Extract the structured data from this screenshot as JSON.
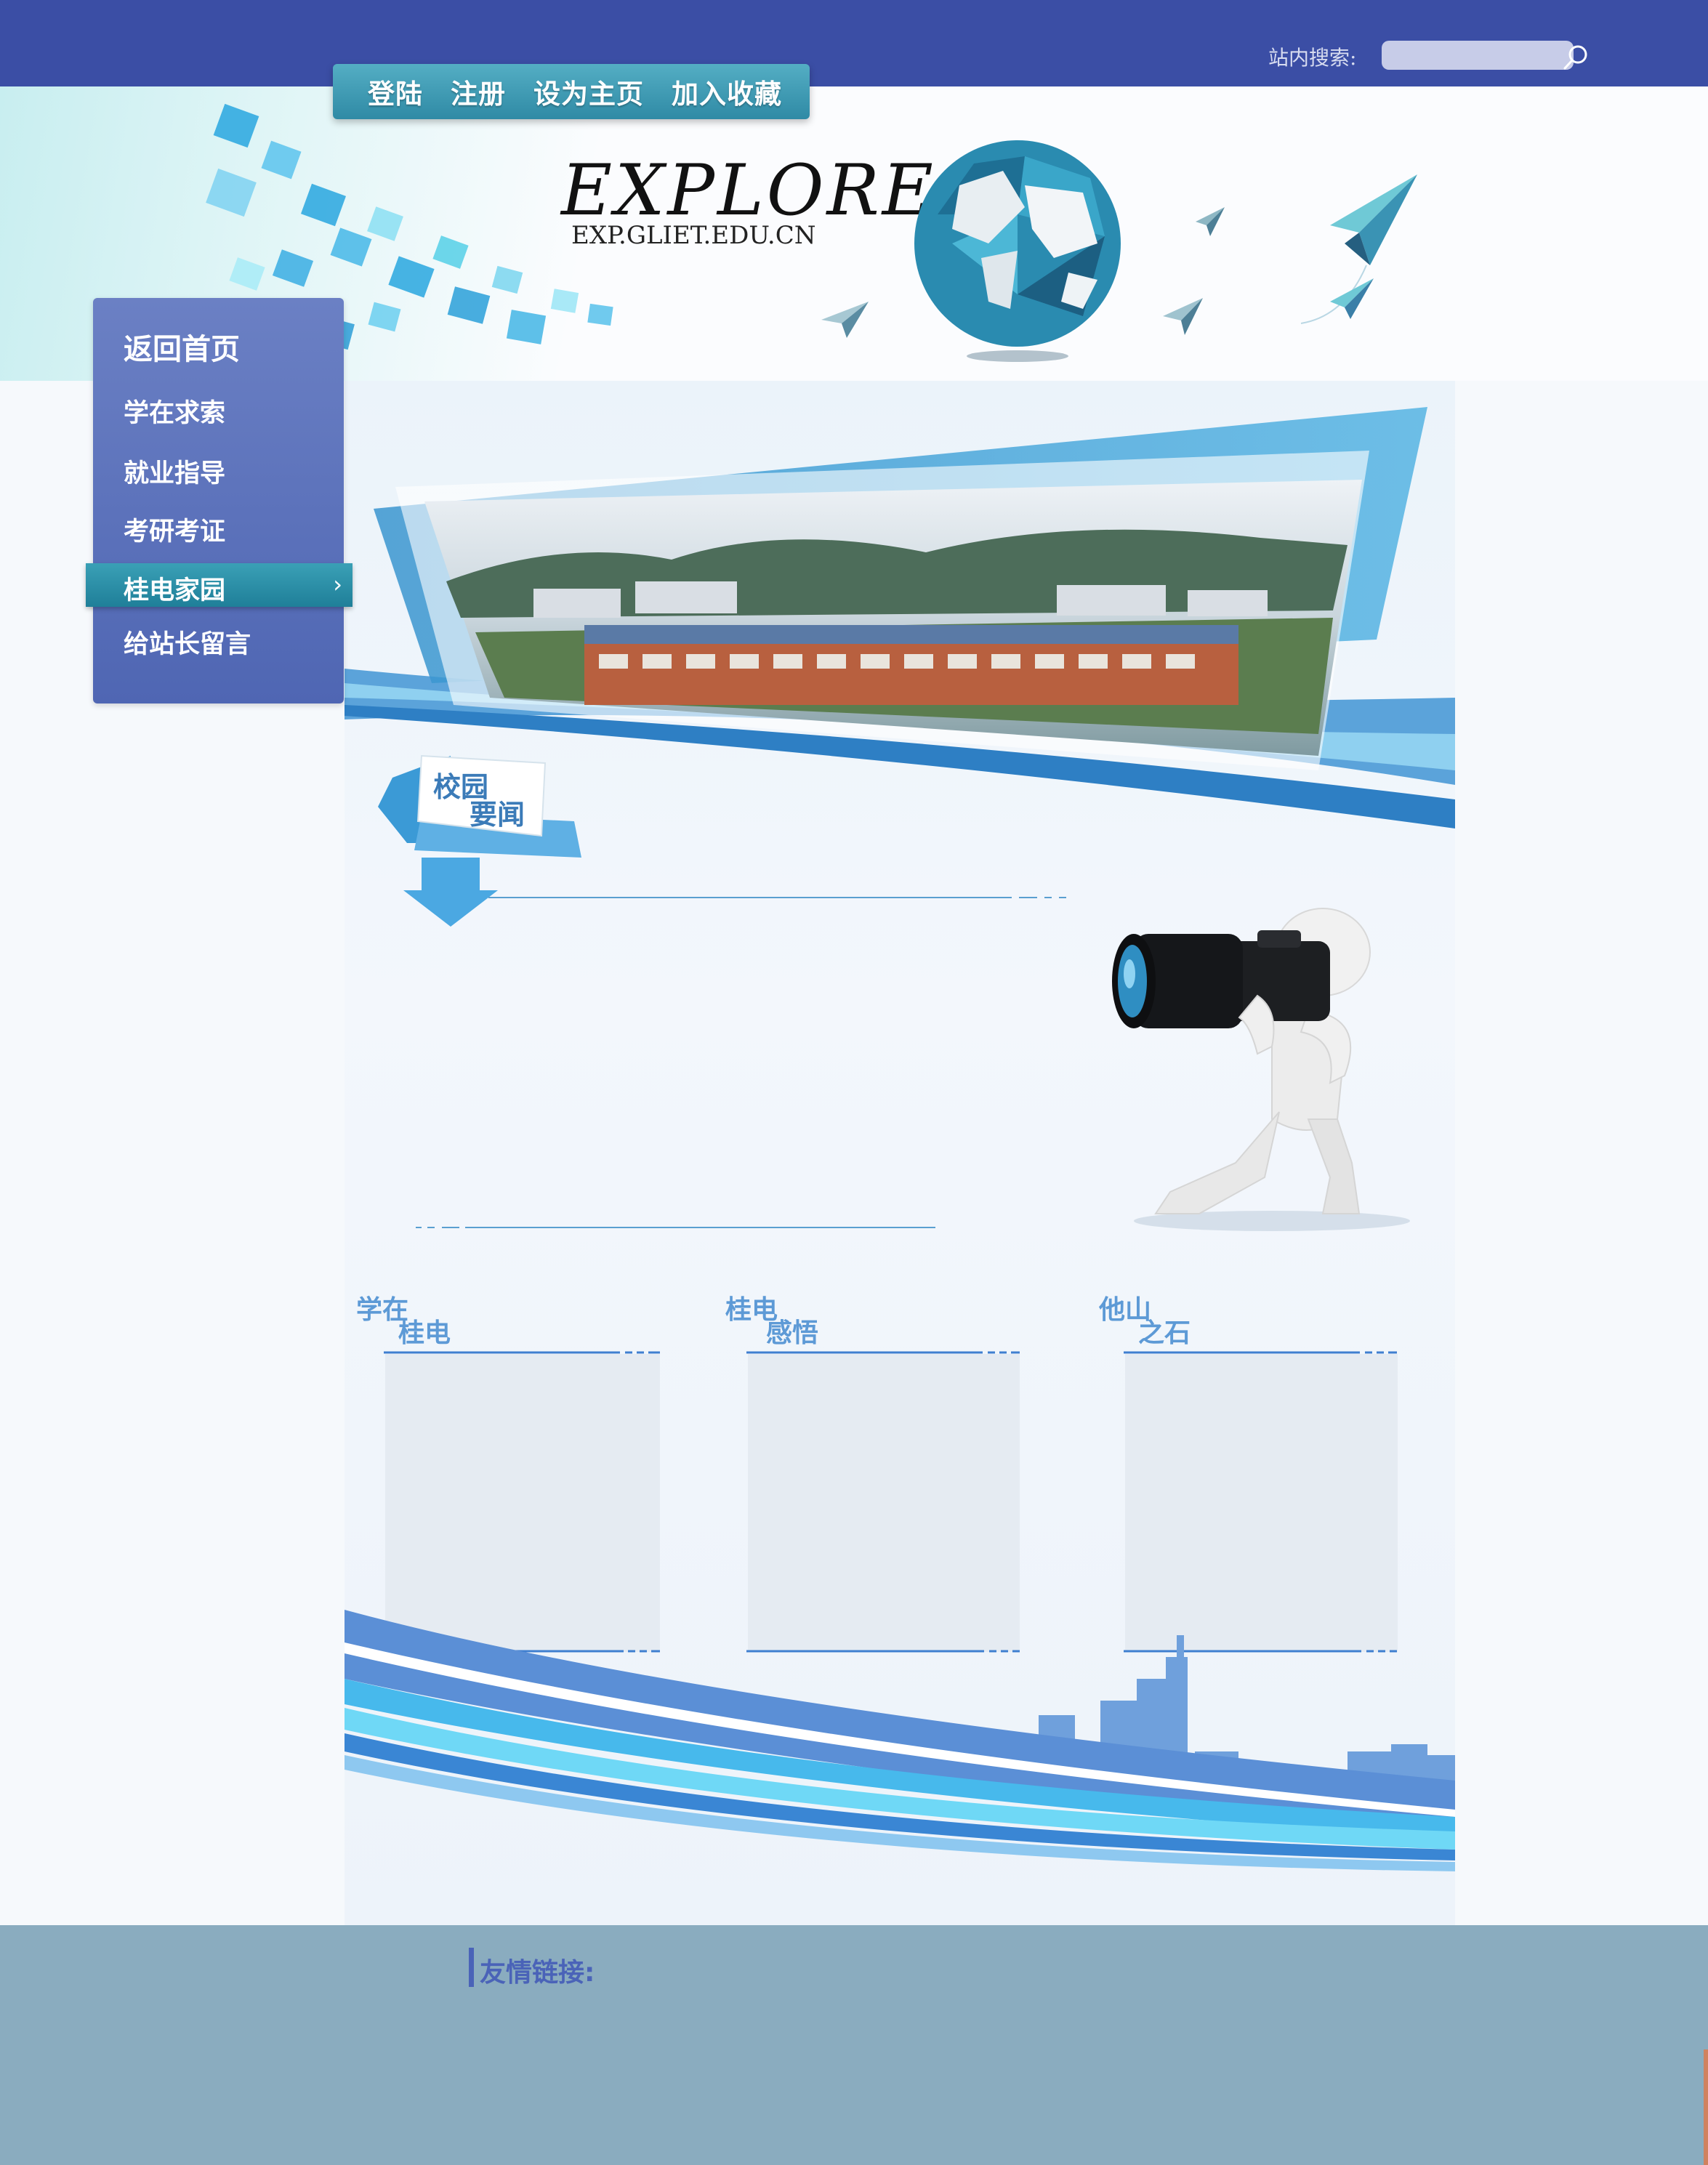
{
  "header": {
    "search_label": "站内搜索:",
    "search_placeholder": "",
    "top_nav": [
      "登陆",
      "注册",
      "设为主页",
      "加入收藏"
    ],
    "logo_main": "EXPLORE",
    "logo_sub": "EXP.GLIET.EDU.CN"
  },
  "sidebar": {
    "home": "返回首页",
    "items": [
      "学在求索",
      "就业指导",
      "考研考证",
      "桂电家园",
      "给站长留言"
    ],
    "active_index": 3
  },
  "main": {
    "news_title_line1": "校园",
    "news_title_line2": "要闻",
    "sections": [
      {
        "line1": "学在",
        "line2": "桂电"
      },
      {
        "line1": "桂电",
        "line2": "感悟"
      },
      {
        "line1": "他山",
        "line2": "之石"
      }
    ]
  },
  "footer": {
    "links_title": "友情链接:"
  },
  "colors": {
    "topbar": "#3b4ea5",
    "nav_teal": "#2f8aa5",
    "sidebar": "#5469b5",
    "footer": "#8aacbf",
    "accent_blue": "#5d9ad6"
  }
}
